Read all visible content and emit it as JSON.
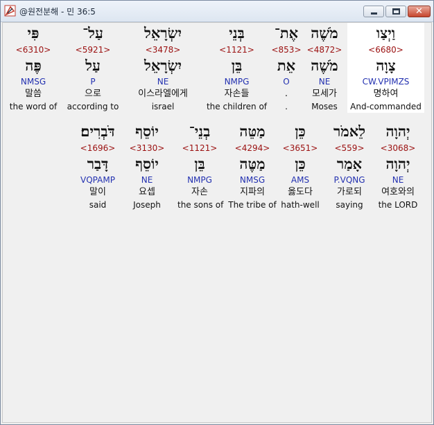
{
  "window": {
    "title": "@원전분해 - 민 36:5",
    "close_symbol": "✕"
  },
  "rows": [
    [
      {
        "heb": "וַיְצַו",
        "num": "<6680>",
        "lemma": "צָוָה",
        "morph": "CW.VPIMZS",
        "kor": "명하여",
        "eng": "And-commanded",
        "highlight": true
      },
      {
        "heb": "מֹשֶׁה",
        "num": "<4872>",
        "lemma": "מֹשֶׁה",
        "morph": "NE",
        "kor": "모세가",
        "eng": "Moses"
      },
      {
        "heb": "אֶת־",
        "num": "<853>",
        "lemma": "אֵת",
        "morph": "O",
        "kor": ".",
        "eng": "."
      },
      {
        "heb": "בְּנֵי",
        "num": "<1121>",
        "lemma": "בֵּן",
        "morph": "NMPG",
        "kor": "자손들",
        "eng": "the children of"
      },
      {
        "heb": "יִשְׂרָאֵל",
        "num": "<3478>",
        "lemma": "יִשְׂרָאֵל",
        "morph": "NE",
        "kor": "이스라엘에게",
        "eng": "israel"
      },
      {
        "heb": "עַל־",
        "num": "<5921>",
        "lemma": "עַל",
        "morph": "P",
        "kor": "으로",
        "eng": "according to"
      },
      {
        "heb": "פִּי",
        "num": "<6310>",
        "lemma": "פֶּה",
        "morph": "NMSG",
        "kor": "말씀",
        "eng": "the word of"
      }
    ],
    [
      {
        "heb": "יְהוָה",
        "num": "<3068>",
        "lemma": "יְהוָה",
        "morph": "NE",
        "kor": "여호와의",
        "eng": "the LORD"
      },
      {
        "heb": "לֵאמֹר",
        "num": "<559>",
        "lemma": "אָמַר",
        "morph": "P.VQNG",
        "kor": "가로되",
        "eng": "saying"
      },
      {
        "heb": "כֵּן",
        "num": "<3651>",
        "lemma": "כֵּן",
        "morph": "AMS",
        "kor": "옳도다",
        "eng": "hath-well"
      },
      {
        "heb": "מַטֵּה",
        "num": "<4294>",
        "lemma": "מַטֶּה",
        "morph": "NMSG",
        "kor": "지파의",
        "eng": "The tribe of"
      },
      {
        "heb": "בְנֵי־",
        "num": "<1121>",
        "lemma": "בֵּן",
        "morph": "NMPG",
        "kor": "자손",
        "eng": "the sons of"
      },
      {
        "heb": "יוֹסֵף",
        "num": "<3130>",
        "lemma": "יוֹסֵף",
        "morph": "NE",
        "kor": "요셉",
        "eng": "Joseph"
      },
      {
        "heb": "דֹּבְרִים׃",
        "num": "<1696>",
        "lemma": "דָּבַר",
        "morph": "VQPAMP",
        "kor": "말이",
        "eng": "said"
      }
    ]
  ]
}
